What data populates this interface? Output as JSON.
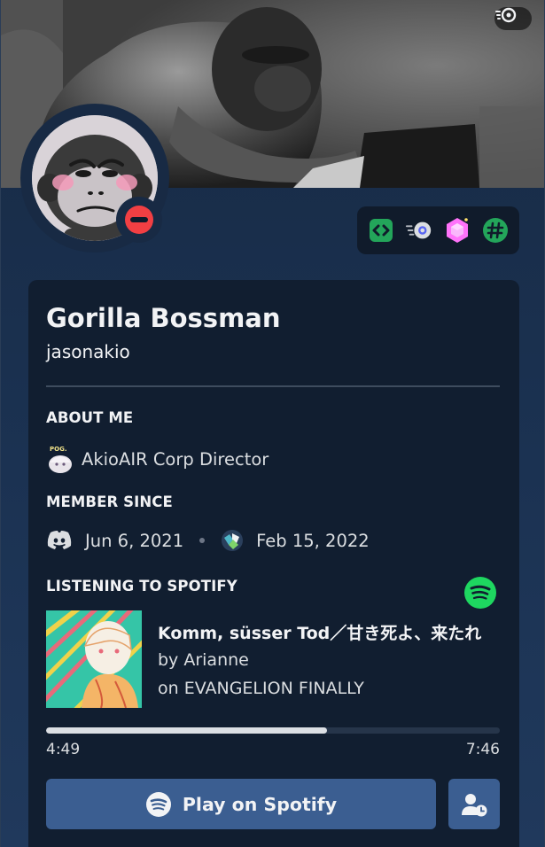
{
  "user": {
    "display_name": "Gorilla Bossman",
    "username": "jasonakio",
    "status": "do-not-disturb"
  },
  "badges": [
    {
      "icon": "active-developer-badge-icon",
      "color": "#23a55a"
    },
    {
      "icon": "nitro-badge-icon",
      "color": "#b5bac1"
    },
    {
      "icon": "server-booster-gem-icon",
      "color": "#ff73fa"
    },
    {
      "icon": "hashtag-badge-icon",
      "color": "#23a55a"
    }
  ],
  "about_me": {
    "title": "ABOUT ME",
    "emoji_caption": "POG.",
    "text": "AkioAIR Corp Director"
  },
  "member_since": {
    "title": "MEMBER SINCE",
    "discord_date": "Jun 6, 2021",
    "server_date": "Feb 15, 2022"
  },
  "spotify": {
    "title": "LISTENING TO SPOTIFY",
    "track": "Komm, süsser Tod／甘き死よ、来たれ",
    "artist": "by Arianne",
    "album": "on EVANGELION FINALLY",
    "elapsed": "4:49",
    "total": "7:46",
    "progress_fraction": 0.62,
    "play_label": "Play on Spotify",
    "accent": "#1ed760"
  },
  "colors": {
    "button": "#3b5e91",
    "card": "#111e30",
    "dnd": "#f23f43"
  }
}
